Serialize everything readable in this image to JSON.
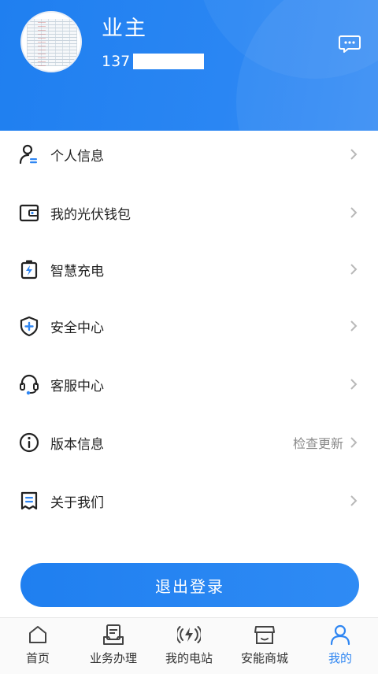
{
  "colors": {
    "primary": "#1f7ff0",
    "text": "#222222",
    "muted": "#8a8a8a",
    "active_tab": "#2f86f2"
  },
  "profile": {
    "name": "业主",
    "phone_prefix": "137",
    "avatar_icon": "spreadsheet-avatar",
    "message_icon": "message-icon"
  },
  "menu": [
    {
      "label": "个人信息",
      "icon": "person-icon"
    },
    {
      "label": "我的光伏钱包",
      "icon": "wallet-icon"
    },
    {
      "label": "智慧充电",
      "icon": "battery-charge-icon"
    },
    {
      "label": "安全中心",
      "icon": "shield-plus-icon"
    },
    {
      "label": "客服中心",
      "icon": "headset-icon"
    },
    {
      "label": "版本信息",
      "icon": "info-icon",
      "extra": "检查更新"
    },
    {
      "label": "关于我们",
      "icon": "receipt-icon"
    }
  ],
  "logout_label": "退出登录",
  "tabs": [
    {
      "label": "首页",
      "icon": "home-icon"
    },
    {
      "label": "业务办理",
      "icon": "document-tray-icon"
    },
    {
      "label": "我的电站",
      "icon": "power-station-icon"
    },
    {
      "label": "安能商城",
      "icon": "store-icon"
    },
    {
      "label": "我的",
      "icon": "user-icon",
      "active": true
    }
  ]
}
